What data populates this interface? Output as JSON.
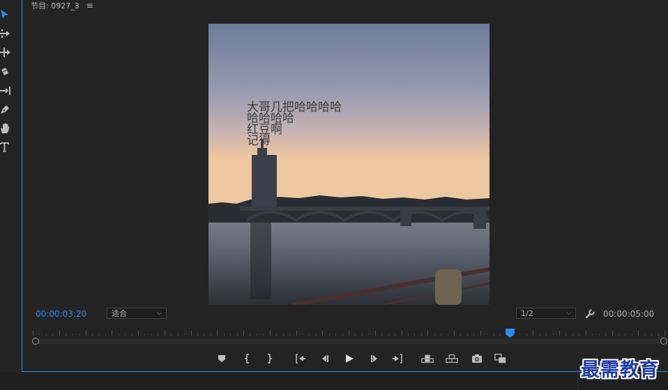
{
  "panel": {
    "title": "节目: 0927_3",
    "menu_icon": "hamburger-menu-icon",
    "accent_color": "#2d8ceb"
  },
  "tools": [
    {
      "name": "selection-tool-icon"
    },
    {
      "name": "track-select-forward-tool-icon"
    },
    {
      "name": "ripple-edit-tool-icon"
    },
    {
      "name": "razor-tool-icon"
    },
    {
      "name": "slip-tool-icon"
    },
    {
      "name": "pen-tool-icon"
    },
    {
      "name": "hand-tool-icon"
    },
    {
      "name": "type-tool-icon"
    }
  ],
  "monitor": {
    "overlay_text": [
      "大哥几把哈哈哈哈",
      "哈哈哈哈",
      "红豆啊",
      "记得"
    ],
    "current_timecode": "00:00:03:20",
    "duration_timecode": "00:00:05:00",
    "zoom_select": "适合",
    "resolution_select": "1/2",
    "playhead_position_fraction": 0.76
  },
  "transport": [
    {
      "name": "add-marker-button"
    },
    {
      "name": "mark-in-button"
    },
    {
      "name": "mark-out-button"
    },
    {
      "name": "go-to-in-button"
    },
    {
      "name": "step-back-button"
    },
    {
      "name": "play-button"
    },
    {
      "name": "step-forward-button"
    },
    {
      "name": "go-to-out-button"
    },
    {
      "name": "lift-button"
    },
    {
      "name": "extract-button"
    },
    {
      "name": "export-frame-button"
    },
    {
      "name": "comparison-view-button"
    }
  ],
  "watermark": "最需教育"
}
